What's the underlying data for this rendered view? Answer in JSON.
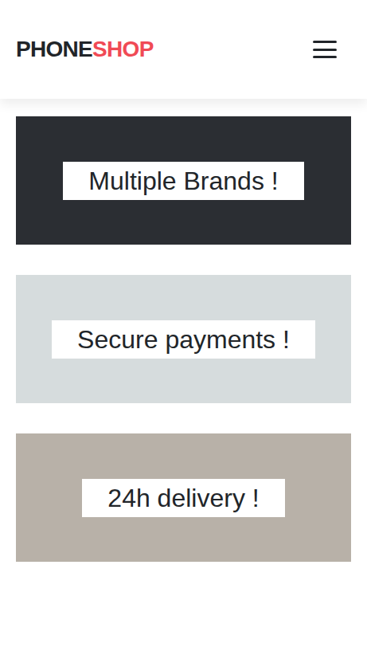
{
  "header": {
    "logo": [
      {
        "text": "PHONE",
        "color": "#212529"
      },
      {
        "text": "SHOP",
        "color": "#f04a55"
      }
    ]
  },
  "features": [
    {
      "label": "Multiple Brands !",
      "color": "#2b2e33"
    },
    {
      "label": "Secure payments !",
      "color": "#d6dcdd"
    },
    {
      "label": "24h delivery !",
      "color": "#b8b1a8"
    }
  ]
}
